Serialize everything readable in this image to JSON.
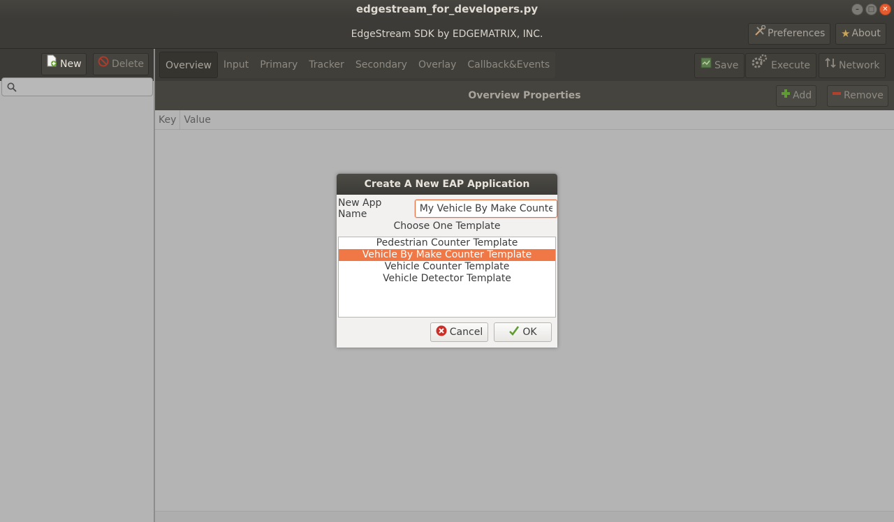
{
  "window": {
    "title": "edgestream_for_developers.py",
    "controls": [
      "minimize",
      "maximize",
      "close"
    ]
  },
  "header": {
    "title": "EdgeStream SDK by EDGEMATRIX, INC.",
    "preferences_label": "Preferences",
    "about_label": "About"
  },
  "left_toolbar": {
    "new_label": "New",
    "delete_label": "Delete"
  },
  "search": {
    "placeholder": ""
  },
  "tabs": [
    {
      "label": "Overview",
      "active": true
    },
    {
      "label": "Input"
    },
    {
      "label": "Primary"
    },
    {
      "label": "Tracker"
    },
    {
      "label": "Secondary"
    },
    {
      "label": "Overlay"
    },
    {
      "label": "Callback&Events"
    }
  ],
  "right_toolbar": {
    "save_label": "Save",
    "execute_label": "Execute",
    "network_label": "Network"
  },
  "section": {
    "title": "Overview Properties",
    "add_label": "Add",
    "remove_label": "Remove"
  },
  "table": {
    "columns": [
      "Key",
      "Value"
    ],
    "rows": []
  },
  "dialog": {
    "title": "Create A New EAP Application",
    "name_label": "New App Name",
    "name_value": "My Vehicle By Make Counter",
    "choose_label": "Choose One Template",
    "templates": [
      {
        "label": "Pedestrian Counter Template",
        "selected": false
      },
      {
        "label": "Vehicle By Make Counter Template",
        "selected": true
      },
      {
        "label": "Vehicle Counter Template",
        "selected": false
      },
      {
        "label": "Vehicle Detector Template",
        "selected": false
      }
    ],
    "cancel_label": "Cancel",
    "ok_label": "OK"
  },
  "colors": {
    "accent": "#f07746",
    "dark_bar": "#3c3b37",
    "background": "#b4b4b4"
  }
}
